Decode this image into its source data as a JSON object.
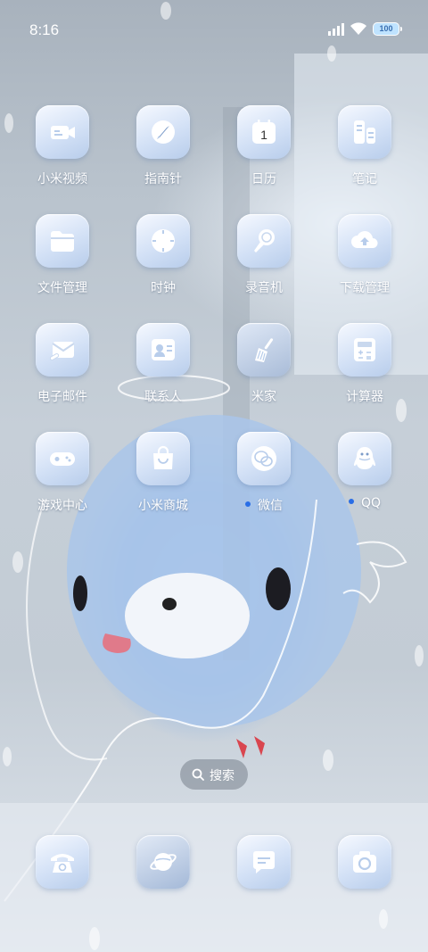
{
  "status": {
    "time": "8:16",
    "battery": "100"
  },
  "apps": [
    {
      "label": "小米视频",
      "icon": "video-camera-icon"
    },
    {
      "label": "指南针",
      "icon": "compass-icon"
    },
    {
      "label": "日历",
      "icon": "calendar-icon",
      "date": "1"
    },
    {
      "label": "笔记",
      "icon": "notes-icon"
    },
    {
      "label": "文件管理",
      "icon": "folder-icon"
    },
    {
      "label": "时钟",
      "icon": "clock-icon"
    },
    {
      "label": "录音机",
      "icon": "microphone-icon"
    },
    {
      "label": "下载管理",
      "icon": "cloud-download-icon"
    },
    {
      "label": "电子邮件",
      "icon": "mail-icon"
    },
    {
      "label": "联系人",
      "icon": "contacts-icon"
    },
    {
      "label": "米家",
      "icon": "broom-icon"
    },
    {
      "label": "计算器",
      "icon": "calculator-icon"
    },
    {
      "label": "游戏中心",
      "icon": "gamepad-icon"
    },
    {
      "label": "小米商城",
      "icon": "shopping-bag-icon"
    },
    {
      "label": "微信",
      "icon": "wechat-icon",
      "new_badge": true
    },
    {
      "label": "QQ",
      "icon": "qq-penguin-icon",
      "new_badge": true
    }
  ],
  "search": {
    "label": "搜索"
  },
  "dock": [
    {
      "name": "phone",
      "icon": "telephone-icon"
    },
    {
      "name": "browser",
      "icon": "planet-icon"
    },
    {
      "name": "messages",
      "icon": "message-bubble-icon"
    },
    {
      "name": "camera",
      "icon": "camera-icon"
    }
  ],
  "colors": {
    "badge": "#2a6ee6",
    "icon_tile": "#d3e1f6"
  }
}
